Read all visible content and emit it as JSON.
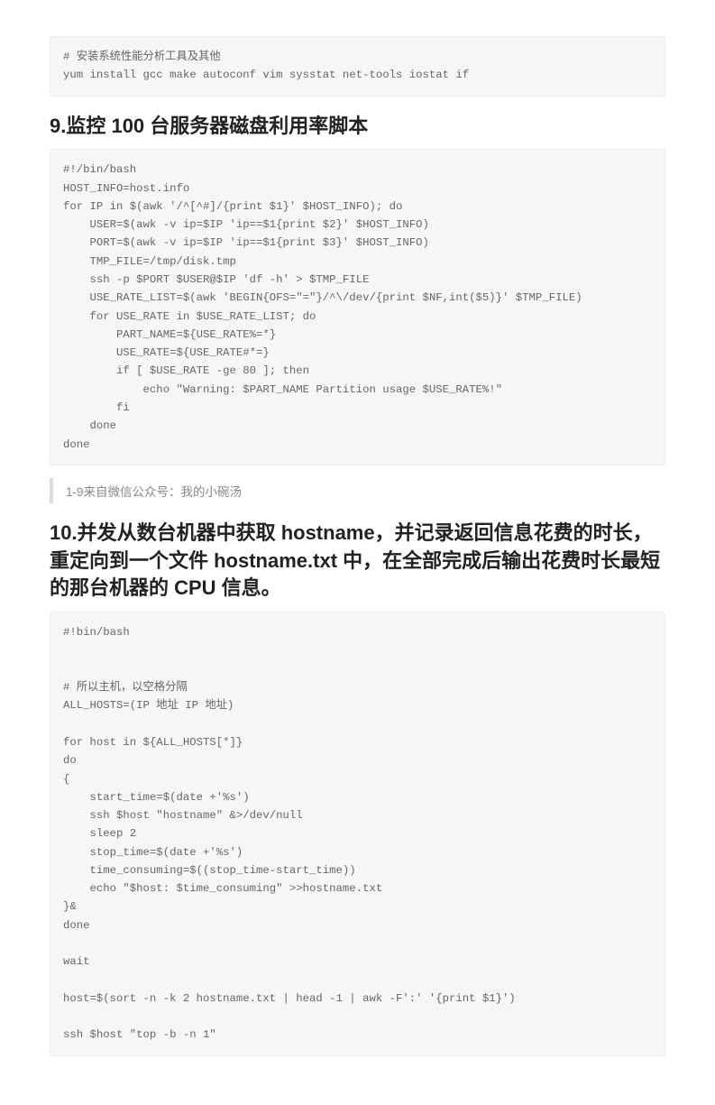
{
  "codeblock1": "# 安装系统性能分析工具及其他\nyum install gcc make autoconf vim sysstat net-tools iostat if",
  "heading9": "9.监控 100 台服务器磁盘利用率脚本",
  "codeblock2": "#!/bin/bash\nHOST_INFO=host.info\nfor IP in $(awk '/^[^#]/{print $1}' $HOST_INFO); do\n    USER=$(awk -v ip=$IP 'ip==$1{print $2}' $HOST_INFO)\n    PORT=$(awk -v ip=$IP 'ip==$1{print $3}' $HOST_INFO)\n    TMP_FILE=/tmp/disk.tmp\n    ssh -p $PORT $USER@$IP 'df -h' > $TMP_FILE\n    USE_RATE_LIST=$(awk 'BEGIN{OFS=\"=\"}/^\\/dev/{print $NF,int($5)}' $TMP_FILE)\n    for USE_RATE in $USE_RATE_LIST; do\n        PART_NAME=${USE_RATE%=*}\n        USE_RATE=${USE_RATE#*=}\n        if [ $USE_RATE -ge 80 ]; then\n            echo \"Warning: $PART_NAME Partition usage $USE_RATE%!\"\n        fi\n    done\ndone",
  "blockquote": "1-9来自微信公众号：我的小碗汤",
  "heading10": "10.并发从数台机器中获取 hostname，并记录返回信息花费的时长，重定向到一个文件 hostname.txt 中，在全部完成后输出花费时长最短的那台机器的 CPU 信息。",
  "codeblock3": "#!bin/bash\n\n\n# 所以主机，以空格分隔\nALL_HOSTS=(IP 地址 IP 地址)\n\nfor host in ${ALL_HOSTS[*]}\ndo\n{\n    start_time=$(date +'%s')\n    ssh $host \"hostname\" &>/dev/null\n    sleep 2\n    stop_time=$(date +'%s')\n    time_consuming=$((stop_time-start_time))\n    echo \"$host: $time_consuming\" >>hostname.txt\n}&\ndone\n\nwait\n\nhost=$(sort -n -k 2 hostname.txt | head -1 | awk -F':' '{print $1}')\n\nssh $host \"top -b -n 1\""
}
